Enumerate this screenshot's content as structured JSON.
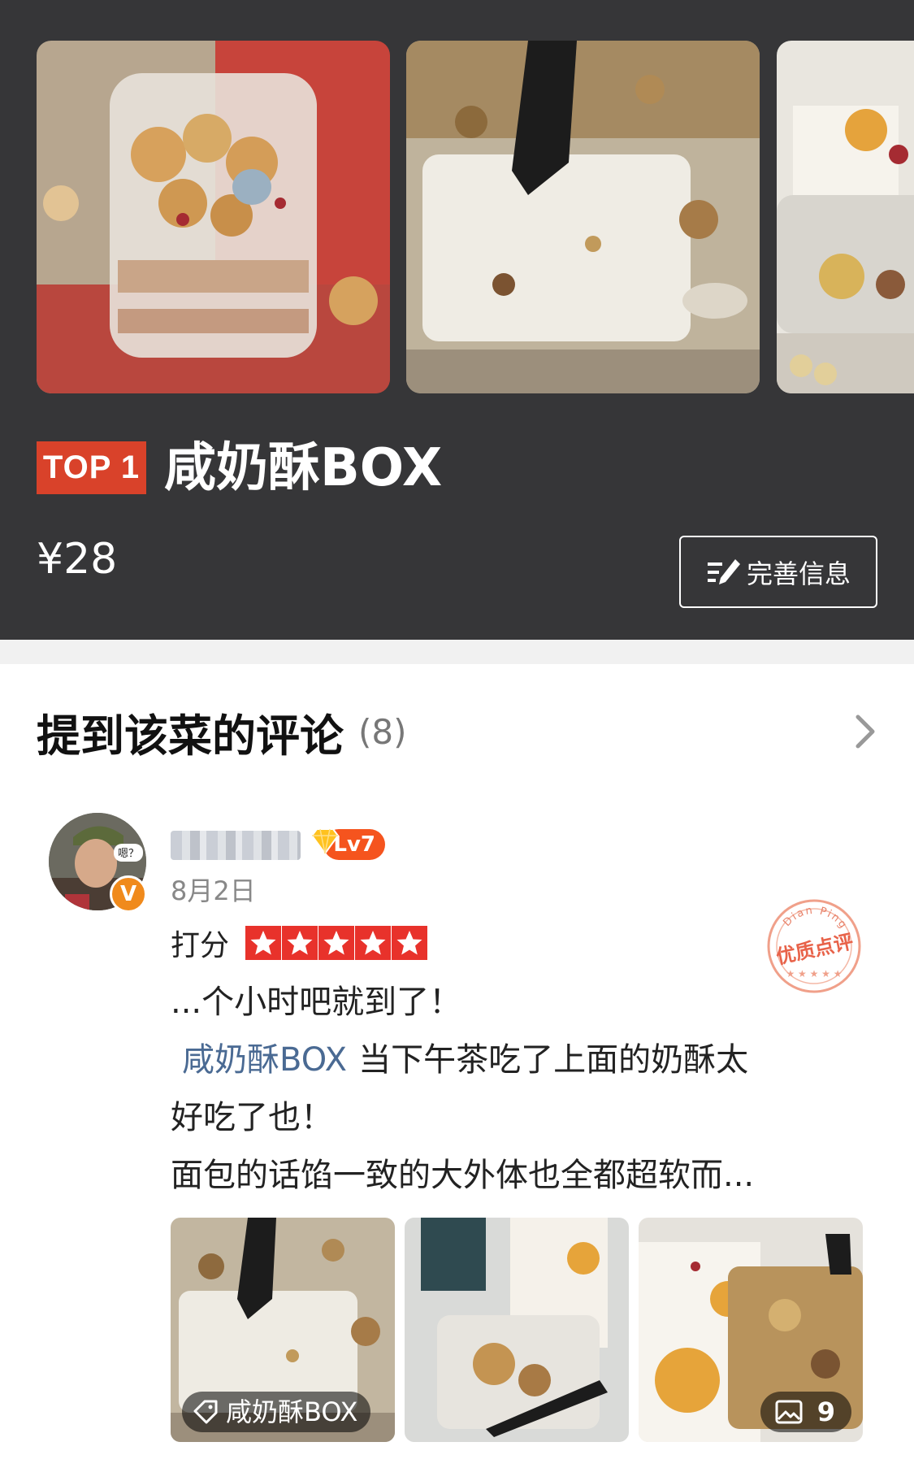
{
  "product": {
    "rank_badge": "TOP 1",
    "name": "咸奶酥BOX",
    "price": "¥28",
    "improve_button": "完善信息",
    "photos": [
      "dessert-cup-photo",
      "spoon-closeup-photo",
      "packaged-box-photo"
    ]
  },
  "reviews_section": {
    "title": "提到该菜的评论",
    "count": "(8)"
  },
  "review": {
    "avatar_caption": "嗯？",
    "verified_badge": "V",
    "level": "Lv7",
    "date": "8月2日",
    "rating_label": "打分",
    "rating": 5,
    "rating_max": 5,
    "stamp_arc_text": "Dian Ping",
    "stamp_main_text": "优质点评",
    "text_line1": "...个小时吧就到了！",
    "dish_link": "咸奶酥BOX",
    "text_after_link": "当下午茶吃了上面的奶酥太",
    "text_line3": "好吃了也！",
    "text_line4": "面包的话馅一致的大外体也全都超软而...",
    "photo_tag": "咸奶酥BOX",
    "photo_count": "9"
  },
  "colors": {
    "header_bg": "#363638",
    "badge_red": "#d9422a",
    "star_red": "#e8322b",
    "link_blue": "#4a6a93",
    "level_orange": "#f5541e",
    "verified_orange": "#f08a1c"
  },
  "icons": [
    "edit-list-icon",
    "chevron-right-icon",
    "diamond-icon",
    "star-icon",
    "tag-icon",
    "image-icon"
  ]
}
